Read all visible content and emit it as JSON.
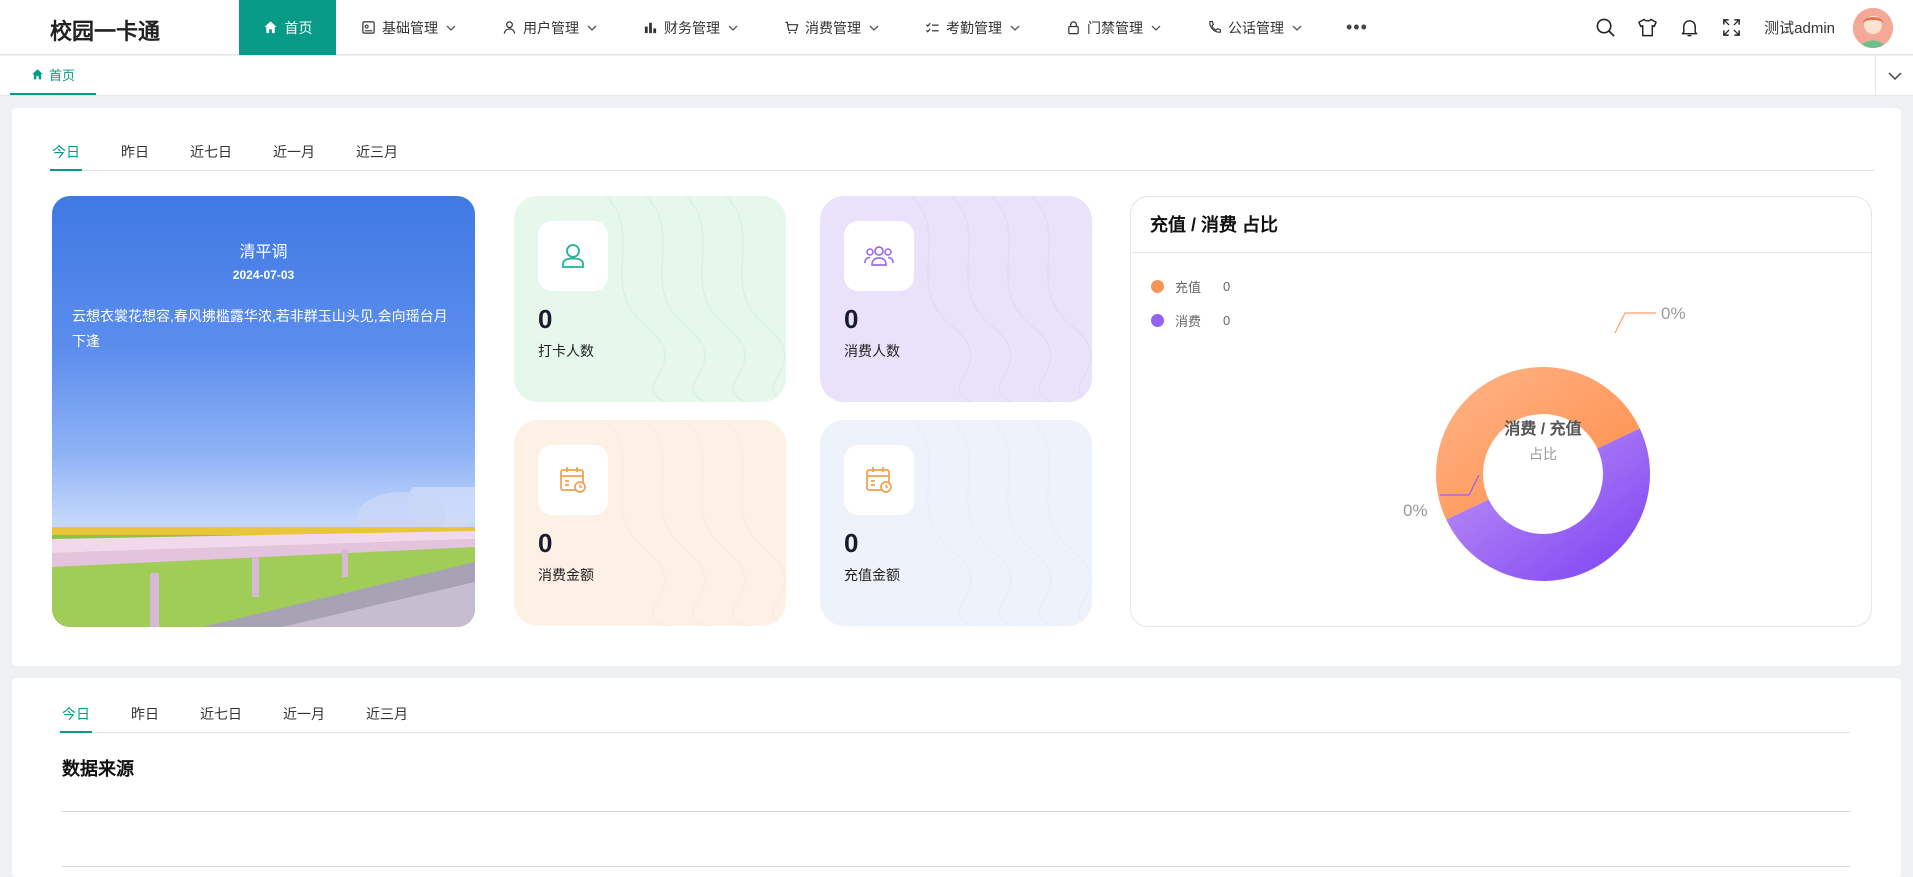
{
  "app": {
    "title": "校园一卡通"
  },
  "nav": {
    "items": [
      {
        "label": "首页",
        "icon": "home-icon"
      },
      {
        "label": "基础管理",
        "icon": "basic-icon"
      },
      {
        "label": "用户管理",
        "icon": "user-icon"
      },
      {
        "label": "财务管理",
        "icon": "bar-chart-icon"
      },
      {
        "label": "消费管理",
        "icon": "cart-icon"
      },
      {
        "label": "考勤管理",
        "icon": "checklist-icon"
      },
      {
        "label": "门禁管理",
        "icon": "lock-icon"
      },
      {
        "label": "公话管理",
        "icon": "phone-icon"
      }
    ],
    "more": "•••"
  },
  "header": {
    "username": "测试admin"
  },
  "tabs": {
    "home": "首页"
  },
  "range_tabs": [
    "今日",
    "昨日",
    "近七日",
    "近一月",
    "近三月"
  ],
  "poem": {
    "title": "清平调",
    "date": "2024-07-03",
    "text": "云想衣裳花想容,春风拂槛露华浓,若非群玉山头见,会向瑶台月下逢"
  },
  "stats": [
    {
      "value": "0",
      "label": "打卡人数",
      "icon": "user-card-icon",
      "color": "#1fb394",
      "bg": "#e6f7ec"
    },
    {
      "value": "0",
      "label": "消费人数",
      "icon": "group-icon",
      "color": "#9b6cf0",
      "bg": "#e9e2fa"
    },
    {
      "value": "0",
      "label": "消费金额",
      "icon": "calendar-clock-icon",
      "color": "#f3a04b",
      "bg": "#fdf1e6"
    },
    {
      "value": "0",
      "label": "充值金额",
      "icon": "calendar-clock-icon",
      "color": "#f3a04b",
      "bg": "#eef3fb"
    }
  ],
  "ratio": {
    "title": "充值 / 消费 占比",
    "center_title": "消费 / 充值",
    "center_sub": "占比",
    "legend": [
      {
        "name": "充值",
        "value": "0",
        "color": "#f79458"
      },
      {
        "name": "消费",
        "value": "0",
        "color": "#9462f1"
      }
    ],
    "labels": {
      "recharge": "0%",
      "consume": "0%"
    }
  },
  "chart_data": {
    "type": "pie",
    "categories": [
      "充值",
      "消费"
    ],
    "values": [
      0,
      0
    ],
    "title": "充值 / 消费 占比"
  },
  "section2": {
    "title": "数据来源"
  }
}
